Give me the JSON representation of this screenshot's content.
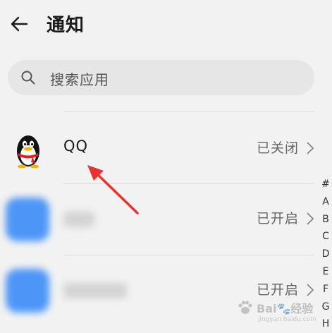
{
  "header": {
    "title": "通知",
    "back_icon": "arrow-left-icon"
  },
  "search": {
    "placeholder": "搜索应用",
    "icon": "search-icon"
  },
  "apps": [
    {
      "name": "QQ",
      "status": "已关闭",
      "icon": "qq-penguin-icon"
    },
    {
      "name": "",
      "status": "已开启",
      "icon": "blurred-app-icon",
      "name_blurred": true
    },
    {
      "name": "",
      "status": "已开启",
      "icon": "blurred-app-icon",
      "name_blurred": true
    }
  ],
  "index_letters": [
    "#",
    "A",
    "B",
    "C",
    "D",
    "E",
    "F",
    "G",
    "H"
  ],
  "watermark": {
    "text": "Bai🐾经验",
    "url": "jingyan.baidu.com"
  },
  "colors": {
    "background": "#f2f2f2",
    "search_bg": "#e6e6e6",
    "annotation_arrow": "#e8322f",
    "blurred_icon": "#4d96f8"
  }
}
